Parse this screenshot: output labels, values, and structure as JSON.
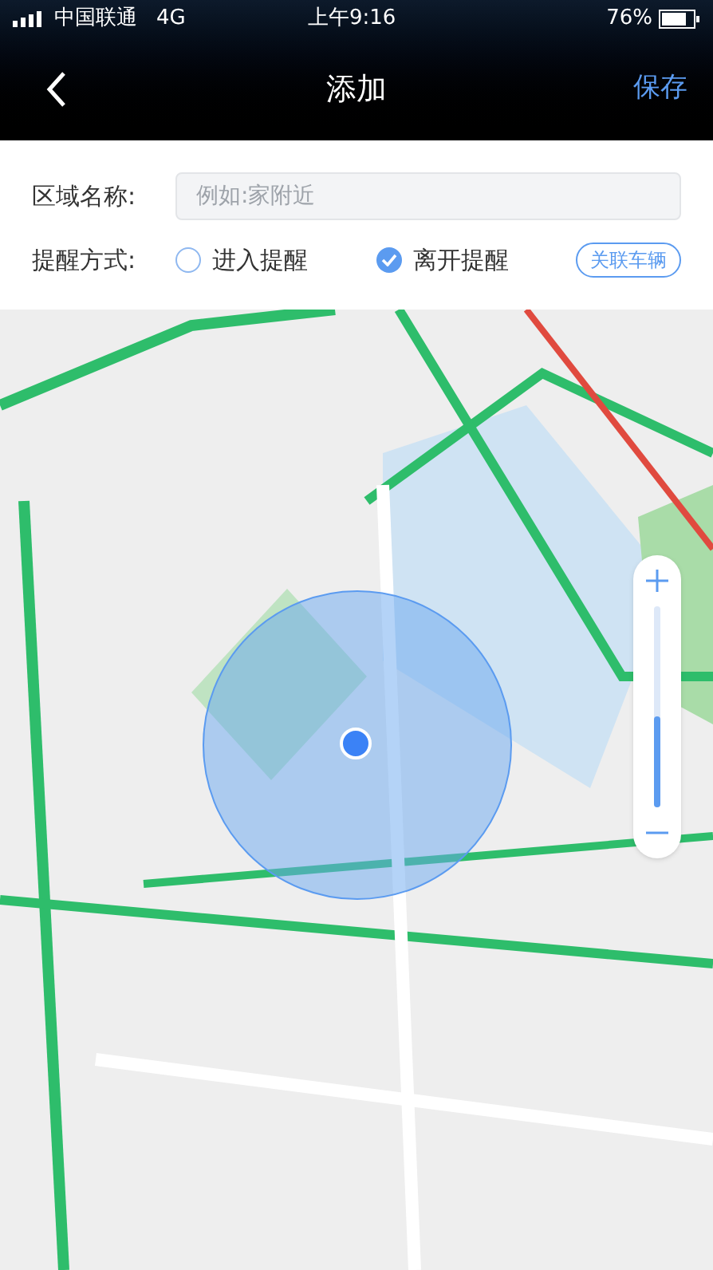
{
  "status_bar": {
    "carrier": "中国联通",
    "network": "4G",
    "time": "上午9:16",
    "battery": "76%"
  },
  "nav": {
    "title": "添加",
    "action": "保存"
  },
  "form": {
    "name_label": "区域名称:",
    "name_placeholder": "例如:家附近",
    "mode_label": "提醒方式:",
    "modes": [
      {
        "label": "进入提醒",
        "selected": false
      },
      {
        "label": "离开提醒",
        "selected": true
      }
    ],
    "link_button": "关联车辆"
  },
  "map": {
    "kind": "picture",
    "zoom": {
      "level": 0.45
    }
  }
}
